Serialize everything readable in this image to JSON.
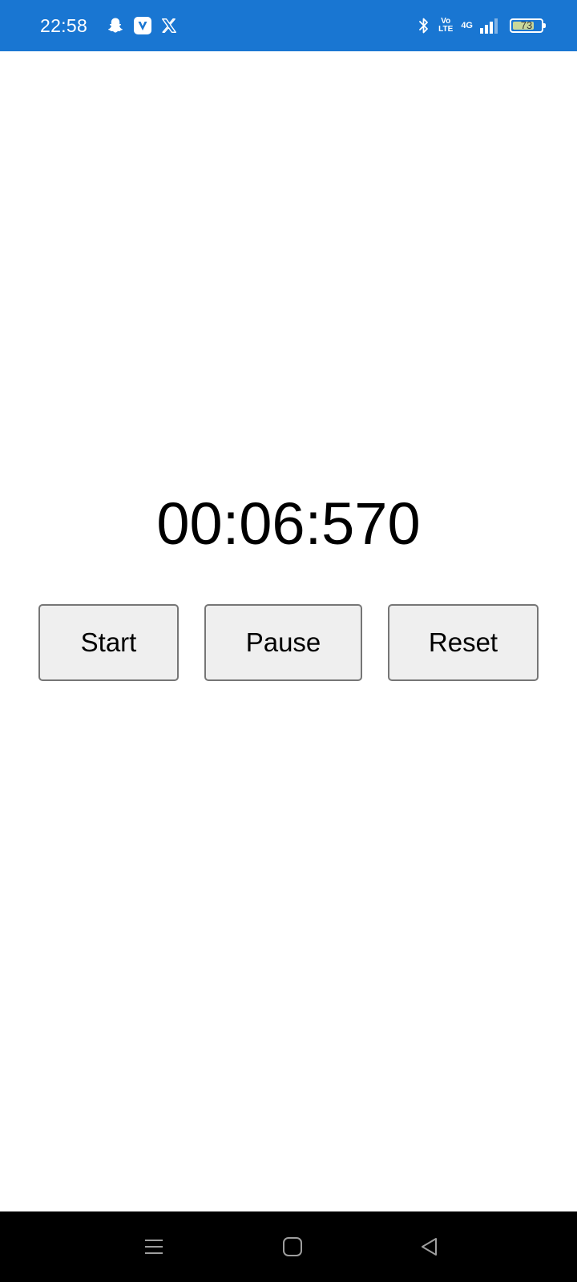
{
  "status_bar": {
    "time": "22:58",
    "left_icons": [
      "snapchat-icon",
      "v-app-icon",
      "x-app-icon"
    ],
    "right_icons": [
      "bluetooth-icon",
      "volte-icon",
      "4g-icon",
      "signal-icon",
      "battery-icon"
    ],
    "volte_top": "Vo",
    "volte_bottom": "LTE",
    "network_type": "4G",
    "battery_level": "73",
    "background_color": "#1976d2"
  },
  "stopwatch": {
    "display": "00:06:570",
    "buttons": {
      "start_label": "Start",
      "pause_label": "Pause",
      "reset_label": "Reset"
    }
  },
  "nav_bar": {
    "items": [
      "recent-apps-icon",
      "home-icon",
      "back-icon"
    ]
  }
}
